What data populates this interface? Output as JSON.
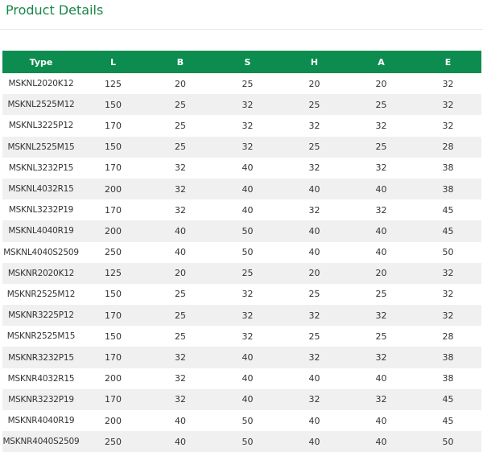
{
  "header": {
    "title": "Product Details"
  },
  "table": {
    "columns": [
      "Type",
      "L",
      "B",
      "S",
      "H",
      "A",
      "E"
    ],
    "rows": [
      [
        "MSKNL2020K12",
        "125",
        "20",
        "25",
        "20",
        "20",
        "32"
      ],
      [
        "MSKNL2525M12",
        "150",
        "25",
        "32",
        "25",
        "25",
        "32"
      ],
      [
        "MSKNL3225P12",
        "170",
        "25",
        "32",
        "32",
        "32",
        "32"
      ],
      [
        "MSKNL2525M15",
        "150",
        "25",
        "32",
        "25",
        "25",
        "28"
      ],
      [
        "MSKNL3232P15",
        "170",
        "32",
        "40",
        "32",
        "32",
        "38"
      ],
      [
        "MSKNL4032R15",
        "200",
        "32",
        "40",
        "40",
        "40",
        "38"
      ],
      [
        "MSKNL3232P19",
        "170",
        "32",
        "40",
        "32",
        "32",
        "45"
      ],
      [
        "MSKNL4040R19",
        "200",
        "40",
        "50",
        "40",
        "40",
        "45"
      ],
      [
        "MSKNL4040S2509",
        "250",
        "40",
        "50",
        "40",
        "40",
        "50"
      ],
      [
        "MSKNR2020K12",
        "125",
        "20",
        "25",
        "20",
        "20",
        "32"
      ],
      [
        "MSKNR2525M12",
        "150",
        "25",
        "32",
        "25",
        "25",
        "32"
      ],
      [
        "MSKNR3225P12",
        "170",
        "25",
        "32",
        "32",
        "32",
        "32"
      ],
      [
        "MSKNR2525M15",
        "150",
        "25",
        "32",
        "25",
        "25",
        "28"
      ],
      [
        "MSKNR3232P15",
        "170",
        "32",
        "40",
        "32",
        "32",
        "38"
      ],
      [
        "MSKNR4032R15",
        "200",
        "32",
        "40",
        "40",
        "40",
        "38"
      ],
      [
        "MSKNR3232P19",
        "170",
        "32",
        "40",
        "32",
        "32",
        "45"
      ],
      [
        "MSKNR4040R19",
        "200",
        "40",
        "50",
        "40",
        "40",
        "45"
      ],
      [
        "MSKNR4040S2509",
        "250",
        "40",
        "50",
        "40",
        "40",
        "50"
      ]
    ]
  },
  "colors": {
    "accent": "#18874a",
    "header_bg": "#0c8c4e",
    "stripe": "#f0f0f0"
  }
}
